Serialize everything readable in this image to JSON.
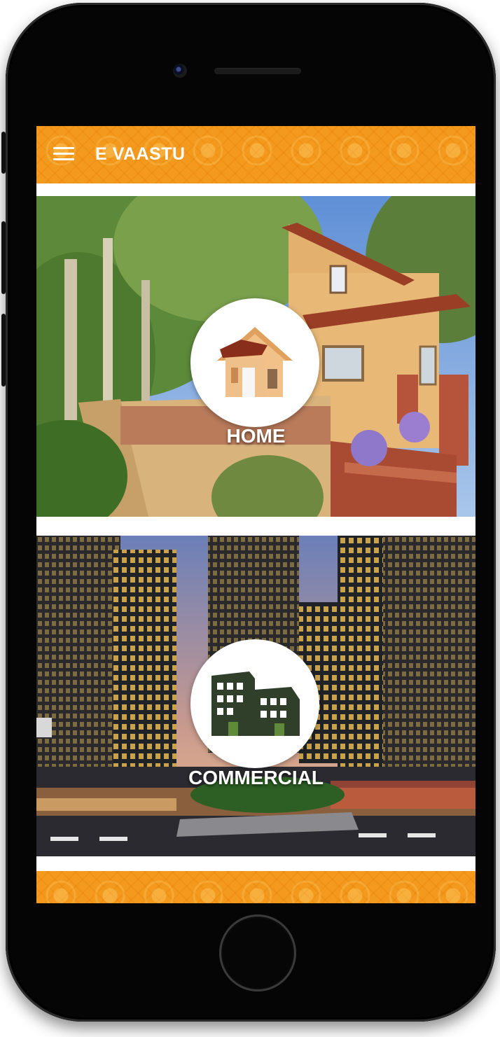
{
  "app": {
    "title": "E VAASTU",
    "accent_color": "#f39a1e"
  },
  "header": {
    "menu_icon": "hamburger-menu-icon"
  },
  "cards": [
    {
      "label": "HOME",
      "icon": "house-icon"
    },
    {
      "label": "COMMERCIAL",
      "icon": "buildings-icon"
    }
  ]
}
